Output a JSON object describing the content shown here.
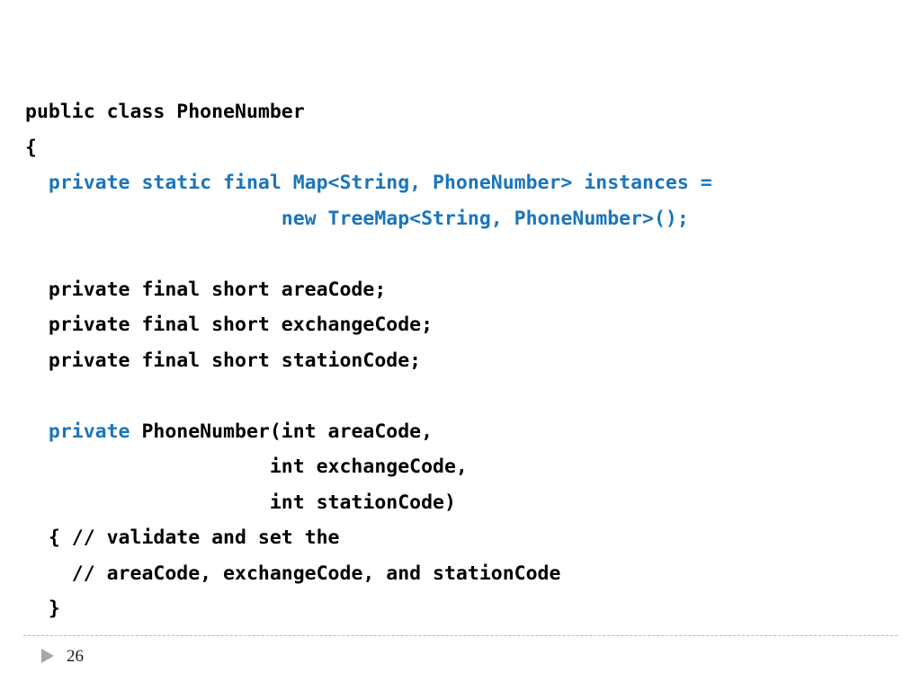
{
  "slide": {
    "background_color": "#ffffff",
    "keyword_color": "#1b75bb",
    "text_color": "#000000",
    "rule_color": "#b8b8b8",
    "marker_color": "#a6a6a6",
    "number": "26",
    "marker_icon": "triangle-right-icon"
  },
  "code": {
    "language": "java",
    "lines": [
      {
        "indent": "",
        "segments": [
          {
            "text": "public class PhoneNumber",
            "style": "plain"
          }
        ]
      },
      {
        "indent": "",
        "segments": [
          {
            "text": "{",
            "style": "plain"
          }
        ]
      },
      {
        "indent": "  ",
        "segments": [
          {
            "text": "private static final Map<String, PhoneNumber> instances =",
            "style": "kw"
          }
        ]
      },
      {
        "indent": "                      ",
        "segments": [
          {
            "text": "new TreeMap<String, PhoneNumber>();",
            "style": "kw"
          }
        ]
      },
      {
        "indent": "",
        "segments": []
      },
      {
        "indent": "  ",
        "segments": [
          {
            "text": "private final short areaCode;",
            "style": "plain"
          }
        ]
      },
      {
        "indent": "  ",
        "segments": [
          {
            "text": "private final short exchangeCode;",
            "style": "plain"
          }
        ]
      },
      {
        "indent": "  ",
        "segments": [
          {
            "text": "private final short stationCode;",
            "style": "plain"
          }
        ]
      },
      {
        "indent": "",
        "segments": []
      },
      {
        "indent": "  ",
        "segments": [
          {
            "text": "private",
            "style": "kw"
          },
          {
            "text": " PhoneNumber(int areaCode,",
            "style": "plain"
          }
        ]
      },
      {
        "indent": "                     ",
        "segments": [
          {
            "text": "int exchangeCode,",
            "style": "plain"
          }
        ]
      },
      {
        "indent": "                     ",
        "segments": [
          {
            "text": "int stationCode)",
            "style": "plain"
          }
        ]
      },
      {
        "indent": "  ",
        "segments": [
          {
            "text": "{ // validate and set the",
            "style": "plain"
          }
        ]
      },
      {
        "indent": "    ",
        "segments": [
          {
            "text": "// areaCode, exchangeCode, and stationCode",
            "style": "plain"
          }
        ]
      },
      {
        "indent": "  ",
        "segments": [
          {
            "text": "}",
            "style": "plain"
          }
        ]
      }
    ]
  }
}
